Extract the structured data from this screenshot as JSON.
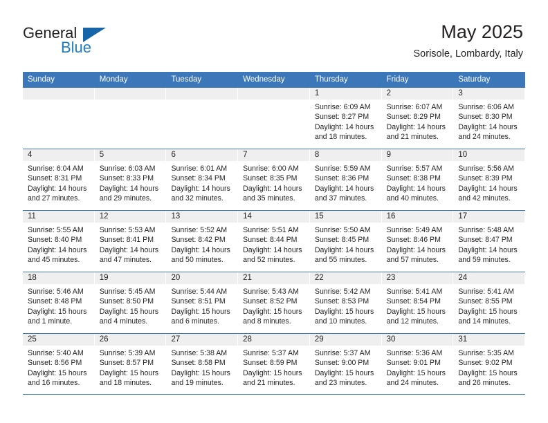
{
  "logo": {
    "word1": "General",
    "word2": "Blue",
    "triangle": "blue-triangle-icon",
    "color_black": "#231f20",
    "color_blue": "#1d7cc4"
  },
  "header": {
    "title": "May 2025",
    "subtitle": "Sorisole, Lombardy, Italy"
  },
  "theme": {
    "header_blue": "#3c77b9",
    "day_number_bar": "#efefef",
    "text": "#231f20"
  },
  "weekdays": [
    "Sunday",
    "Monday",
    "Tuesday",
    "Wednesday",
    "Thursday",
    "Friday",
    "Saturday"
  ],
  "weeks": [
    [
      {
        "day": "",
        "sunrise": "",
        "sunset": "",
        "daylight": "",
        "empty": true
      },
      {
        "day": "",
        "sunrise": "",
        "sunset": "",
        "daylight": "",
        "empty": true
      },
      {
        "day": "",
        "sunrise": "",
        "sunset": "",
        "daylight": "",
        "empty": true
      },
      {
        "day": "",
        "sunrise": "",
        "sunset": "",
        "daylight": "",
        "empty": true
      },
      {
        "day": "1",
        "sunrise": "Sunrise: 6:09 AM",
        "sunset": "Sunset: 8:27 PM",
        "daylight": "Daylight: 14 hours and 18 minutes."
      },
      {
        "day": "2",
        "sunrise": "Sunrise: 6:07 AM",
        "sunset": "Sunset: 8:29 PM",
        "daylight": "Daylight: 14 hours and 21 minutes."
      },
      {
        "day": "3",
        "sunrise": "Sunrise: 6:06 AM",
        "sunset": "Sunset: 8:30 PM",
        "daylight": "Daylight: 14 hours and 24 minutes."
      }
    ],
    [
      {
        "day": "4",
        "sunrise": "Sunrise: 6:04 AM",
        "sunset": "Sunset: 8:31 PM",
        "daylight": "Daylight: 14 hours and 27 minutes."
      },
      {
        "day": "5",
        "sunrise": "Sunrise: 6:03 AM",
        "sunset": "Sunset: 8:33 PM",
        "daylight": "Daylight: 14 hours and 29 minutes."
      },
      {
        "day": "6",
        "sunrise": "Sunrise: 6:01 AM",
        "sunset": "Sunset: 8:34 PM",
        "daylight": "Daylight: 14 hours and 32 minutes."
      },
      {
        "day": "7",
        "sunrise": "Sunrise: 6:00 AM",
        "sunset": "Sunset: 8:35 PM",
        "daylight": "Daylight: 14 hours and 35 minutes."
      },
      {
        "day": "8",
        "sunrise": "Sunrise: 5:59 AM",
        "sunset": "Sunset: 8:36 PM",
        "daylight": "Daylight: 14 hours and 37 minutes."
      },
      {
        "day": "9",
        "sunrise": "Sunrise: 5:57 AM",
        "sunset": "Sunset: 8:38 PM",
        "daylight": "Daylight: 14 hours and 40 minutes."
      },
      {
        "day": "10",
        "sunrise": "Sunrise: 5:56 AM",
        "sunset": "Sunset: 8:39 PM",
        "daylight": "Daylight: 14 hours and 42 minutes."
      }
    ],
    [
      {
        "day": "11",
        "sunrise": "Sunrise: 5:55 AM",
        "sunset": "Sunset: 8:40 PM",
        "daylight": "Daylight: 14 hours and 45 minutes."
      },
      {
        "day": "12",
        "sunrise": "Sunrise: 5:53 AM",
        "sunset": "Sunset: 8:41 PM",
        "daylight": "Daylight: 14 hours and 47 minutes."
      },
      {
        "day": "13",
        "sunrise": "Sunrise: 5:52 AM",
        "sunset": "Sunset: 8:42 PM",
        "daylight": "Daylight: 14 hours and 50 minutes."
      },
      {
        "day": "14",
        "sunrise": "Sunrise: 5:51 AM",
        "sunset": "Sunset: 8:44 PM",
        "daylight": "Daylight: 14 hours and 52 minutes."
      },
      {
        "day": "15",
        "sunrise": "Sunrise: 5:50 AM",
        "sunset": "Sunset: 8:45 PM",
        "daylight": "Daylight: 14 hours and 55 minutes."
      },
      {
        "day": "16",
        "sunrise": "Sunrise: 5:49 AM",
        "sunset": "Sunset: 8:46 PM",
        "daylight": "Daylight: 14 hours and 57 minutes."
      },
      {
        "day": "17",
        "sunrise": "Sunrise: 5:48 AM",
        "sunset": "Sunset: 8:47 PM",
        "daylight": "Daylight: 14 hours and 59 minutes."
      }
    ],
    [
      {
        "day": "18",
        "sunrise": "Sunrise: 5:46 AM",
        "sunset": "Sunset: 8:48 PM",
        "daylight": "Daylight: 15 hours and 1 minute."
      },
      {
        "day": "19",
        "sunrise": "Sunrise: 5:45 AM",
        "sunset": "Sunset: 8:50 PM",
        "daylight": "Daylight: 15 hours and 4 minutes."
      },
      {
        "day": "20",
        "sunrise": "Sunrise: 5:44 AM",
        "sunset": "Sunset: 8:51 PM",
        "daylight": "Daylight: 15 hours and 6 minutes."
      },
      {
        "day": "21",
        "sunrise": "Sunrise: 5:43 AM",
        "sunset": "Sunset: 8:52 PM",
        "daylight": "Daylight: 15 hours and 8 minutes."
      },
      {
        "day": "22",
        "sunrise": "Sunrise: 5:42 AM",
        "sunset": "Sunset: 8:53 PM",
        "daylight": "Daylight: 15 hours and 10 minutes."
      },
      {
        "day": "23",
        "sunrise": "Sunrise: 5:41 AM",
        "sunset": "Sunset: 8:54 PM",
        "daylight": "Daylight: 15 hours and 12 minutes."
      },
      {
        "day": "24",
        "sunrise": "Sunrise: 5:41 AM",
        "sunset": "Sunset: 8:55 PM",
        "daylight": "Daylight: 15 hours and 14 minutes."
      }
    ],
    [
      {
        "day": "25",
        "sunrise": "Sunrise: 5:40 AM",
        "sunset": "Sunset: 8:56 PM",
        "daylight": "Daylight: 15 hours and 16 minutes."
      },
      {
        "day": "26",
        "sunrise": "Sunrise: 5:39 AM",
        "sunset": "Sunset: 8:57 PM",
        "daylight": "Daylight: 15 hours and 18 minutes."
      },
      {
        "day": "27",
        "sunrise": "Sunrise: 5:38 AM",
        "sunset": "Sunset: 8:58 PM",
        "daylight": "Daylight: 15 hours and 19 minutes."
      },
      {
        "day": "28",
        "sunrise": "Sunrise: 5:37 AM",
        "sunset": "Sunset: 8:59 PM",
        "daylight": "Daylight: 15 hours and 21 minutes."
      },
      {
        "day": "29",
        "sunrise": "Sunrise: 5:37 AM",
        "sunset": "Sunset: 9:00 PM",
        "daylight": "Daylight: 15 hours and 23 minutes."
      },
      {
        "day": "30",
        "sunrise": "Sunrise: 5:36 AM",
        "sunset": "Sunset: 9:01 PM",
        "daylight": "Daylight: 15 hours and 24 minutes."
      },
      {
        "day": "31",
        "sunrise": "Sunrise: 5:35 AM",
        "sunset": "Sunset: 9:02 PM",
        "daylight": "Daylight: 15 hours and 26 minutes."
      }
    ]
  ]
}
